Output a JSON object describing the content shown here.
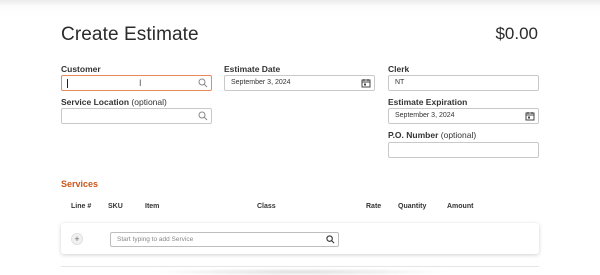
{
  "page": {
    "title": "Create Estimate",
    "total": "$0.00"
  },
  "form": {
    "customer": {
      "label": "Customer",
      "value": ""
    },
    "service_location": {
      "label": "Service Location",
      "optional": "(optional)",
      "value": ""
    },
    "estimate_date": {
      "label": "Estimate Date",
      "value": "September 3, 2024"
    },
    "clerk": {
      "label": "Clerk",
      "value": "NT"
    },
    "estimate_expiration": {
      "label": "Estimate Expiration",
      "value": "September 3, 2024"
    },
    "po_number": {
      "label": "P.O. Number",
      "optional": "(optional)",
      "value": ""
    }
  },
  "services": {
    "section_title": "Services",
    "columns": [
      "Line #",
      "SKU",
      "Item",
      "Class",
      "Rate",
      "Quantity",
      "Amount"
    ],
    "add_button": "+",
    "search_placeholder": "Start typing to add Service"
  },
  "colors": {
    "accent": "#c9571c",
    "focus_border": "#e88a55"
  },
  "icons": {
    "customer": "search-icon",
    "service_location": "search-icon",
    "estimate_date": "calendar-icon",
    "estimate_expiration": "calendar-icon",
    "service_search": "search-icon",
    "cursor": "text-cursor-icon"
  }
}
